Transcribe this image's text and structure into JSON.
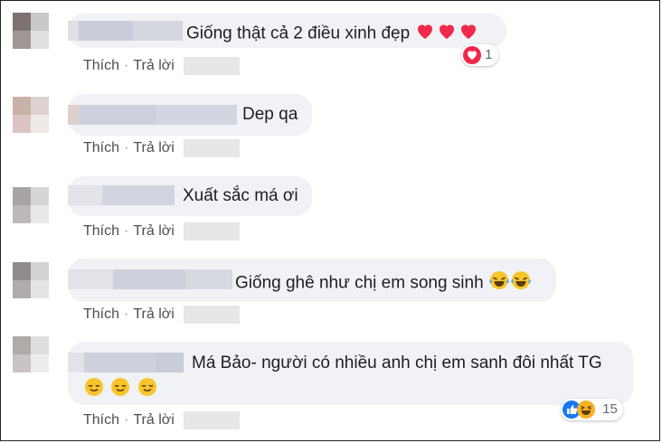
{
  "comments": [
    {
      "text": "Giống thật cả 2 điều xinh đẹp",
      "emoji": [
        "heart",
        "heart",
        "heart"
      ],
      "like_label": "Thích",
      "reply_label": "Trả lời",
      "reaction": {
        "icon": "heart-reaction-icon",
        "count": "1"
      }
    },
    {
      "text": "Dep qa",
      "like_label": "Thích",
      "reply_label": "Trả lời"
    },
    {
      "text": "Xuất sắc má ơi",
      "like_label": "Thích",
      "reply_label": "Trả lời"
    },
    {
      "text": "Giống ghê như chị em song sinh",
      "emoji": [
        "tears-of-joy",
        "tears-of-joy"
      ],
      "like_label": "Thích",
      "reply_label": "Trả lời"
    },
    {
      "text": "Má Bảo- người có nhiều anh chị em sanh đôi nhất TG",
      "emoji": [
        "relieved-face",
        "relieved-face",
        "relieved-face"
      ],
      "like_label": "Thích",
      "reply_label": "Trả lời",
      "reaction": {
        "icon": "like-haha-reaction-icon",
        "count": "15"
      }
    }
  ],
  "colors": {
    "bubble": "#f0f2f5",
    "action_text": "#4b4f56",
    "heart": "#f02849",
    "like_blue": "#1877f2",
    "haha_yellow": "#f7b125"
  }
}
